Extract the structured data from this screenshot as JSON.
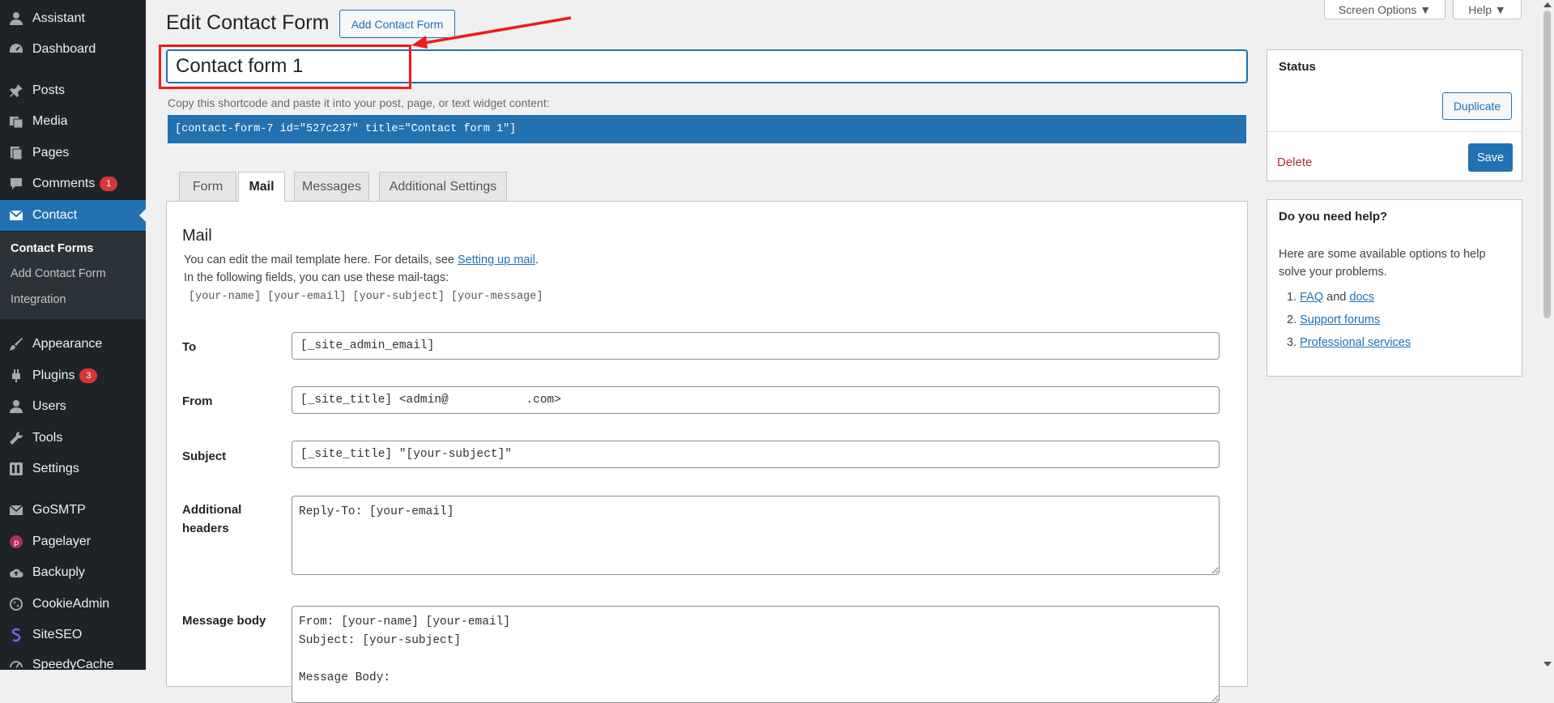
{
  "sidebar": {
    "items": [
      {
        "label": "Assistant",
        "icon": "person-icon"
      },
      {
        "label": "Dashboard",
        "icon": "dashboard-icon"
      },
      {
        "label": "Posts",
        "icon": "pin-icon"
      },
      {
        "label": "Media",
        "icon": "media-icon"
      },
      {
        "label": "Pages",
        "icon": "pages-icon"
      },
      {
        "label": "Comments",
        "icon": "comments-icon",
        "badge": "1"
      },
      {
        "label": "Contact",
        "icon": "envelope-icon",
        "active": true
      },
      {
        "label": "Appearance",
        "icon": "brush-icon"
      },
      {
        "label": "Plugins",
        "icon": "plugin-icon",
        "badge": "3"
      },
      {
        "label": "Users",
        "icon": "users-icon"
      },
      {
        "label": "Tools",
        "icon": "wrench-icon"
      },
      {
        "label": "Settings",
        "icon": "settings-icon"
      },
      {
        "label": "GoSMTP",
        "icon": "mail-icon"
      },
      {
        "label": "Pagelayer",
        "icon": "pagelayer-icon"
      },
      {
        "label": "Backuply",
        "icon": "cloud-upload-icon"
      },
      {
        "label": "CookieAdmin",
        "icon": "cookie-icon"
      },
      {
        "label": "SiteSEO",
        "icon": "siteseo-icon"
      },
      {
        "label": "SpeedyCache",
        "icon": "speedycache-icon"
      }
    ],
    "submenu": [
      "Contact Forms",
      "Add Contact Form",
      "Integration"
    ]
  },
  "header": {
    "title": "Edit Contact Form",
    "add_button": "Add Contact Form",
    "screen_options": "Screen Options ▼",
    "help": "Help ▼"
  },
  "form_title_value": "Contact form 1",
  "shortcode": {
    "hint": "Copy this shortcode and paste it into your post, page, or text widget content:",
    "code": "[contact-form-7 id=\"527c237\" title=\"Contact form 1\"]"
  },
  "tabs": [
    "Form",
    "Mail",
    "Messages",
    "Additional Settings"
  ],
  "mail": {
    "heading": "Mail",
    "desc1_prefix": "You can edit the mail template here. For details, see ",
    "desc1_link": "Setting up mail",
    "desc1_suffix": ".",
    "desc2": "In the following fields, you can use these mail-tags:",
    "mail_tags": "[your-name] [your-email] [your-subject] [your-message]",
    "fields": {
      "to_label": "To",
      "to_value": "[_site_admin_email]",
      "from_label": "From",
      "from_value": "[_site_title] <admin@           .com>",
      "subject_label": "Subject",
      "subject_value": "[_site_title] \"[your-subject]\"",
      "headers_label": "Additional headers",
      "headers_value": "Reply-To: [your-email]",
      "body_label": "Message body",
      "body_value": "From: [your-name] [your-email]\nSubject: [your-subject]\n\nMessage Body:"
    }
  },
  "status_box": {
    "title": "Status",
    "duplicate": "Duplicate",
    "delete": "Delete",
    "save": "Save"
  },
  "help_box": {
    "title": "Do you need help?",
    "text": "Here are some available options to help solve your problems.",
    "item1_num": "1.",
    "faq": "FAQ",
    "and": " and ",
    "docs": "docs",
    "item2_num": "2.",
    "forums": "Support forums",
    "item3_num": "3.",
    "services": "Professional services"
  },
  "colors": {
    "sidebar_bg": "#1d2327",
    "accent": "#2271b1",
    "annotation": "#ee1c1c",
    "badge": "#d63638"
  }
}
